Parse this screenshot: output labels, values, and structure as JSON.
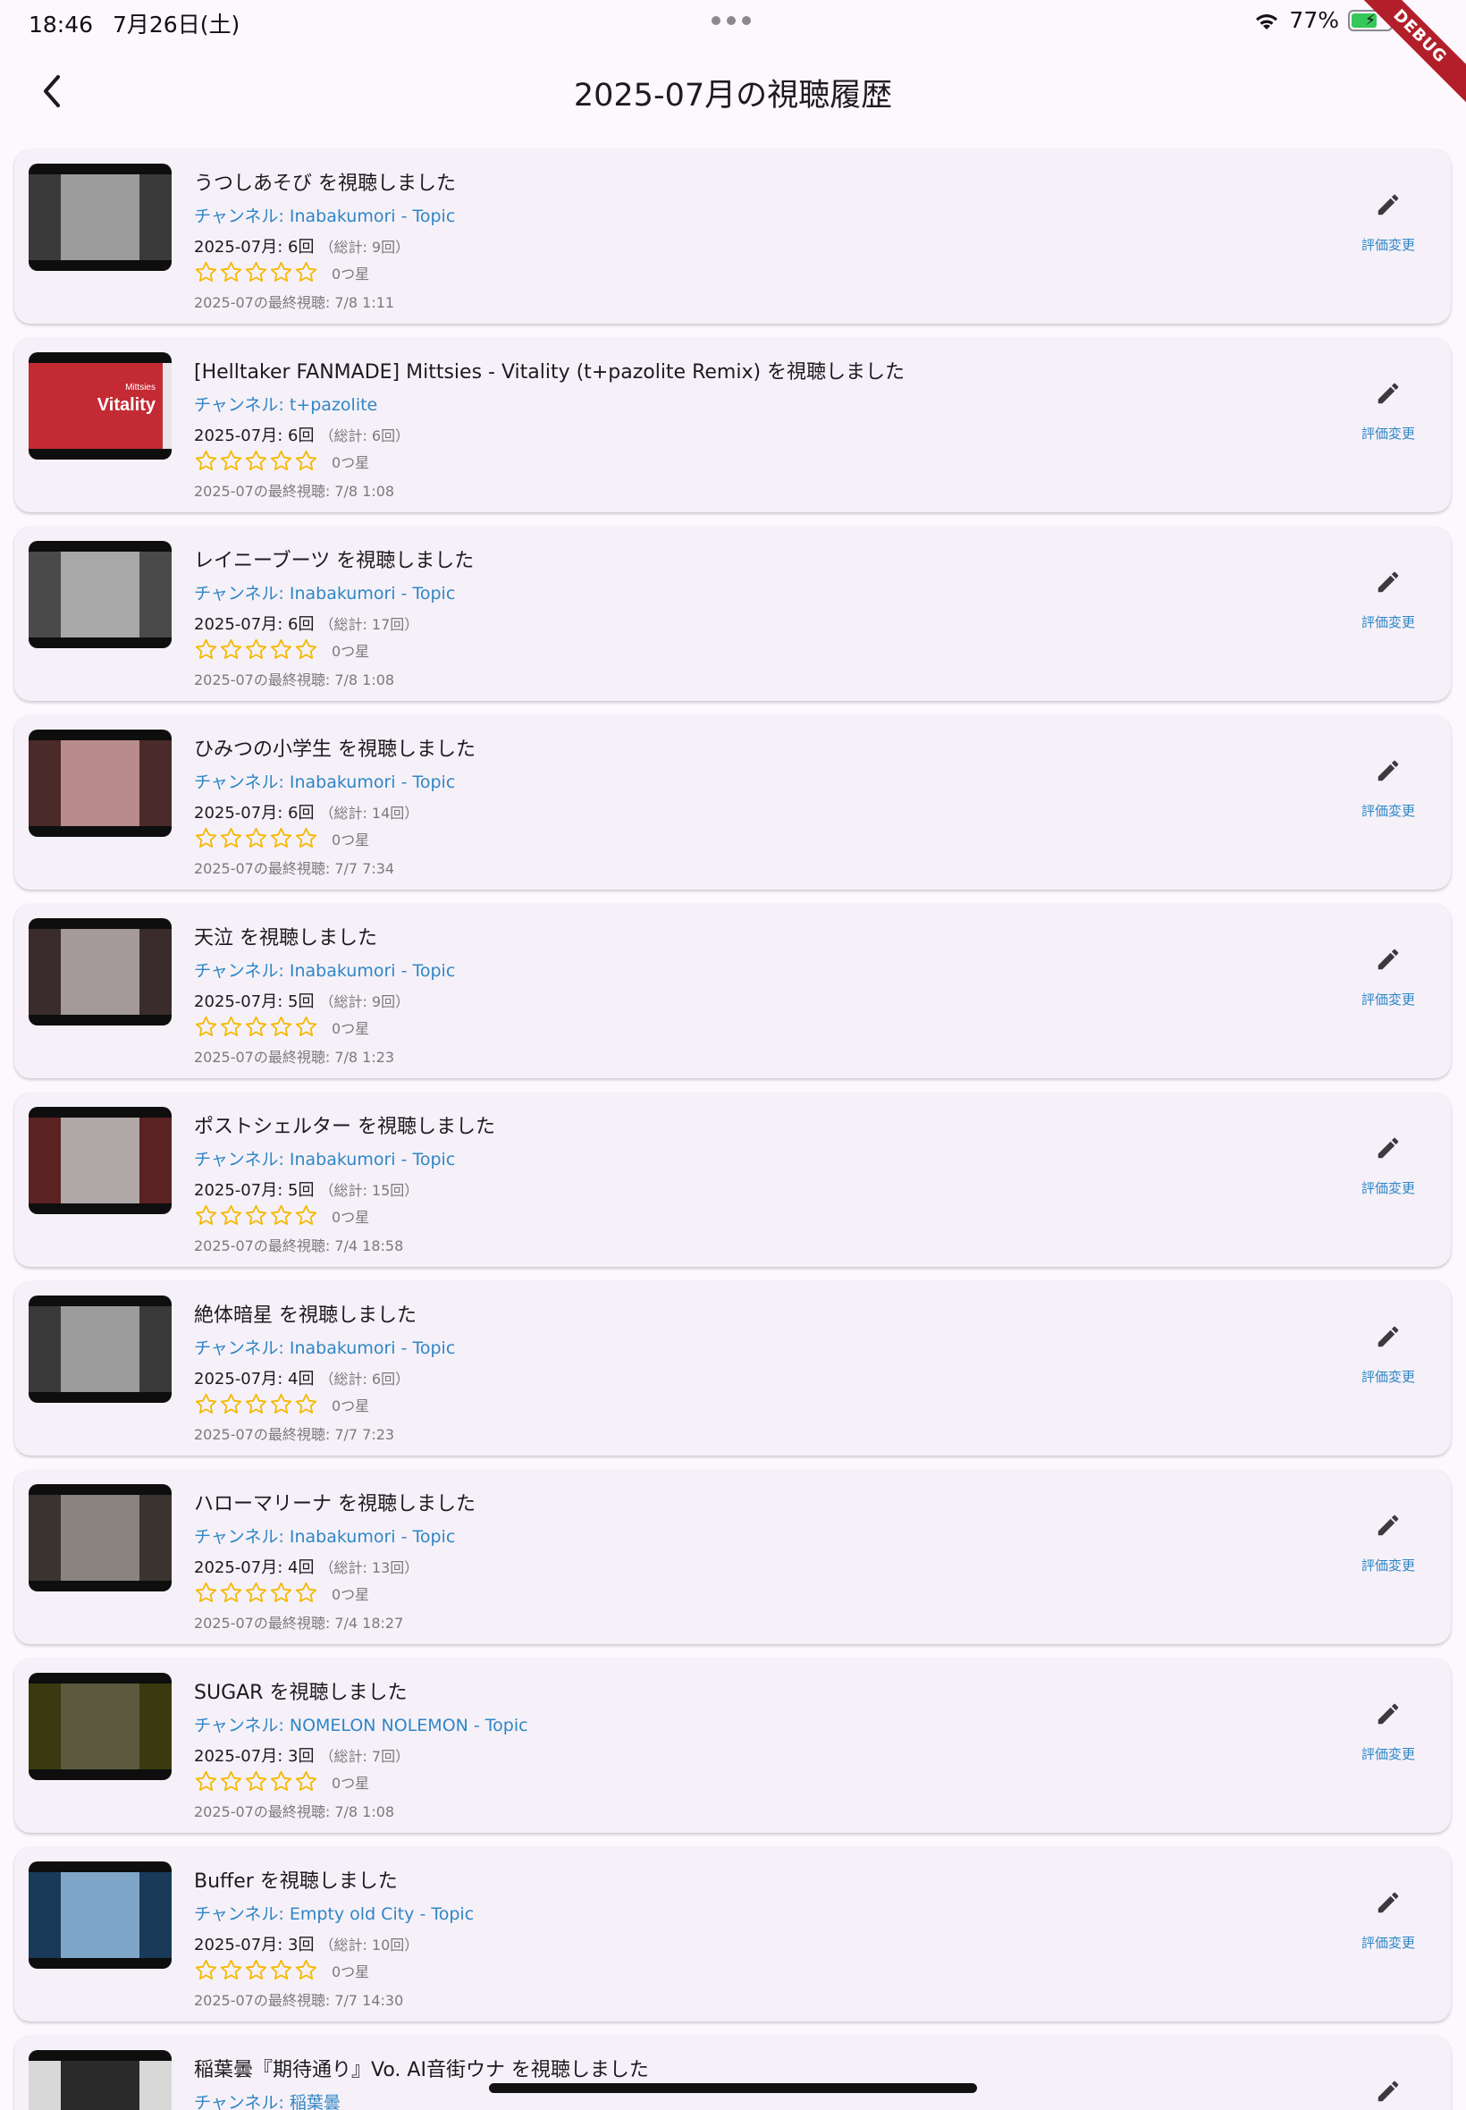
{
  "status_bar": {
    "time": "18:46",
    "date": "7月26日(土)",
    "battery": "77%",
    "debug_label": "DEBUG"
  },
  "app_bar": {
    "title": "2025-07月の視聴履歴",
    "back_icon": "chevron-left-icon"
  },
  "colors": {
    "channel": "#2f86c6",
    "star": "#f5b800",
    "card_bg": "#f6f1f8",
    "page_bg": "#fdf7fe"
  },
  "edit_label": "評価変更",
  "items": [
    {
      "title": "うつしあそび を視聴しました",
      "channel": "チャンネル: Inabakumori - Topic",
      "plays": "2025-07月: 6回",
      "total": "（総計: 9回）",
      "rating_label": "0つ星",
      "last": "2025-07の最終視聴: 7/8 1:11",
      "thumb_bg": "#3a3a3a",
      "art": "#9c9c9c"
    },
    {
      "title": "[Helltaker FANMADE] Mittsies - Vitality (t+pazolite Remix) を視聴しました",
      "channel": "チャンネル: t+pazolite",
      "plays": "2025-07月: 6回",
      "total": "（総計: 6回）",
      "rating_label": "0つ星",
      "last": "2025-07の最終視聴: 7/8 1:08",
      "thumb_bg": "#e9e4e6",
      "art": "#c42a34",
      "thumb_text": "Vitality",
      "thumb_sub": "Mittsies"
    },
    {
      "title": "レイニーブーツ を視聴しました",
      "channel": "チャンネル: Inabakumori - Topic",
      "plays": "2025-07月: 6回",
      "total": "（総計: 17回）",
      "rating_label": "0つ星",
      "last": "2025-07の最終視聴: 7/8 1:08",
      "thumb_bg": "#4a4a4a",
      "art": "#a8a8a8"
    },
    {
      "title": "ひみつの小学生 を視聴しました",
      "channel": "チャンネル: Inabakumori - Topic",
      "plays": "2025-07月: 6回",
      "total": "（総計: 14回）",
      "rating_label": "0つ星",
      "last": "2025-07の最終視聴: 7/7 7:34",
      "thumb_bg": "#4b2a2a",
      "art": "#b88c8c"
    },
    {
      "title": "天泣 を視聴しました",
      "channel": "チャンネル: Inabakumori - Topic",
      "plays": "2025-07月: 5回",
      "total": "（総計: 9回）",
      "rating_label": "0つ星",
      "last": "2025-07の最終視聴: 7/8 1:23",
      "thumb_bg": "#3a2c2c",
      "art": "#a49a9a"
    },
    {
      "title": "ポストシェルター を視聴しました",
      "channel": "チャンネル: Inabakumori - Topic",
      "plays": "2025-07月: 5回",
      "total": "（総計: 15回）",
      "rating_label": "0つ星",
      "last": "2025-07の最終視聴: 7/4 18:58",
      "thumb_bg": "#5a2222",
      "art": "#b0a8a8"
    },
    {
      "title": "絶体暗星 を視聴しました",
      "channel": "チャンネル: Inabakumori - Topic",
      "plays": "2025-07月: 4回",
      "total": "（総計: 6回）",
      "rating_label": "0つ星",
      "last": "2025-07の最終視聴: 7/7 7:23",
      "thumb_bg": "#3a3a3a",
      "art": "#9c9c9c"
    },
    {
      "title": "ハローマリーナ を視聴しました",
      "channel": "チャンネル: Inabakumori - Topic",
      "plays": "2025-07月: 4回",
      "total": "（総計: 13回）",
      "rating_label": "0つ星",
      "last": "2025-07の最終視聴: 7/4 18:27",
      "thumb_bg": "#3a3430",
      "art": "#8a847e"
    },
    {
      "title": "SUGAR を視聴しました",
      "channel": "チャンネル: NOMELON NOLEMON - Topic",
      "plays": "2025-07月: 3回",
      "total": "（総計: 7回）",
      "rating_label": "0つ星",
      "last": "2025-07の最終視聴: 7/8 1:08",
      "thumb_bg": "#3a3a10",
      "art": "#5c5a3e"
    },
    {
      "title": "Buffer を視聴しました",
      "channel": "チャンネル: Empty old City - Topic",
      "plays": "2025-07月: 3回",
      "total": "（総計: 10回）",
      "rating_label": "0つ星",
      "last": "2025-07の最終視聴: 7/7 14:30",
      "thumb_bg": "#1a3a5a",
      "art": "#7fa6c8"
    },
    {
      "title": "稲葉曇『期待通り』Vo. AI音街ウナ を視聴しました",
      "channel": "チャンネル: 稲葉曇",
      "plays": "",
      "total": "",
      "rating_label": "",
      "last": "",
      "thumb_bg": "#d8d8d8",
      "art": "#2a2a2a"
    }
  ]
}
